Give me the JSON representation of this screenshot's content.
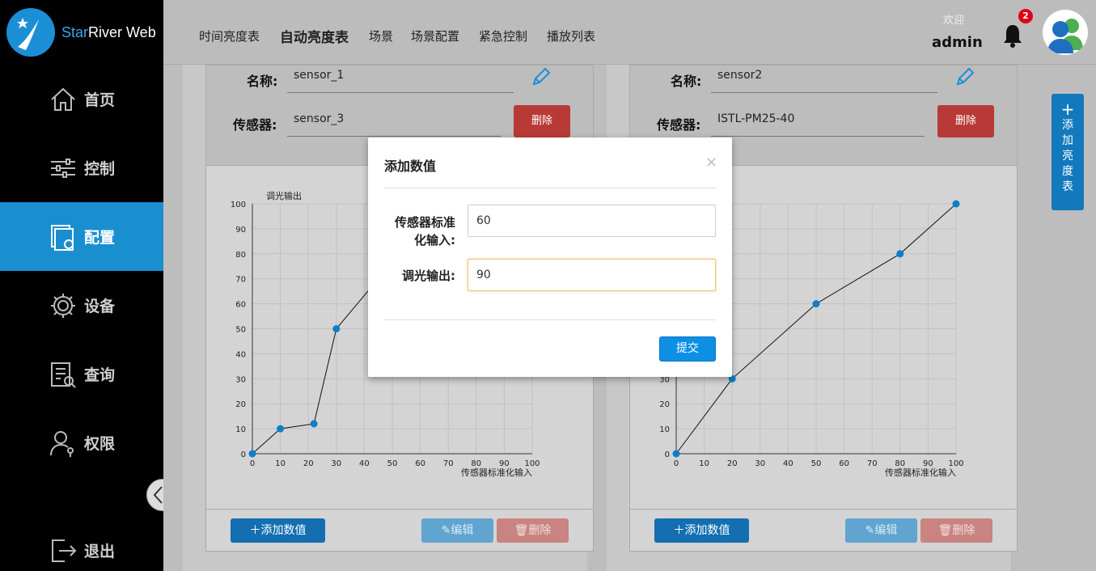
{
  "app": {
    "title_prefix": "Star",
    "title_suffix": "River Web"
  },
  "nav": [
    {
      "label": "首页",
      "icon": "home-icon"
    },
    {
      "label": "控制",
      "icon": "sliders-icon"
    },
    {
      "label": "配置",
      "icon": "config-icon",
      "active": true
    },
    {
      "label": "设备",
      "icon": "gear-icon"
    },
    {
      "label": "查询",
      "icon": "query-icon"
    },
    {
      "label": "权限",
      "icon": "user-key-icon"
    },
    {
      "label": "退出",
      "icon": "logout-icon"
    }
  ],
  "tabs": [
    "时间亮度表",
    "自动亮度表",
    "场景",
    "场景配置",
    "紧急控制",
    "播放列表"
  ],
  "active_tab": "自动亮度表",
  "user": {
    "welcome": "欢迎",
    "name": "admin",
    "notifications": "2"
  },
  "add_brightness_label": [
    "添",
    "加",
    "亮",
    "度",
    "表"
  ],
  "cards": [
    {
      "name_label": "名称:",
      "name_value": "sensor_1",
      "sensor_label": "传感器:",
      "sensor_value": "sensor_3",
      "delete_label": "删除",
      "add_value_label": "添加数值",
      "edit_label": "编辑",
      "remove_label": "删除"
    },
    {
      "name_label": "名称:",
      "name_value": "sensor2",
      "sensor_label": "传感器:",
      "sensor_value": "ISTL-PM25-40",
      "delete_label": "删除",
      "add_value_label": "添加数值",
      "edit_label": "编辑",
      "remove_label": "删除"
    }
  ],
  "chart_data": [
    {
      "type": "line",
      "ylabel": "调光输出",
      "xlabel": "传感器标准化输入",
      "xlim": [
        0,
        100
      ],
      "ylim": [
        0,
        100
      ],
      "xticks": [
        0,
        10,
        20,
        30,
        40,
        50,
        60,
        70,
        80,
        90,
        100
      ],
      "yticks": [
        0,
        10,
        20,
        30,
        40,
        50,
        60,
        70,
        80,
        90,
        100
      ],
      "grid": true,
      "x": [
        0,
        10,
        22,
        30,
        45
      ],
      "y": [
        0,
        10,
        12,
        50,
        70
      ]
    },
    {
      "type": "line",
      "ylabel": "",
      "xlabel": "传感器标准化输入",
      "xlim": [
        0,
        100
      ],
      "ylim": [
        0,
        100
      ],
      "xticks": [
        0,
        10,
        20,
        30,
        40,
        50,
        60,
        70,
        80,
        90,
        100
      ],
      "yticks": [
        0,
        10,
        20,
        30,
        40,
        50,
        60,
        70,
        80,
        90,
        100
      ],
      "grid": true,
      "x": [
        0,
        20,
        50,
        80,
        100
      ],
      "y": [
        0,
        30,
        60,
        80,
        100
      ]
    }
  ],
  "modal": {
    "title": "添加数值",
    "close": "×",
    "field1_label_line1": "传感器标准",
    "field1_label_line2": "化输入:",
    "field1_value": "60",
    "field2_label": "调光输出:",
    "field2_value": "90",
    "submit": "提交"
  },
  "colors": {
    "accent": "#1a8fd0",
    "danger": "#b83a36",
    "point": "#0c7fc7"
  }
}
